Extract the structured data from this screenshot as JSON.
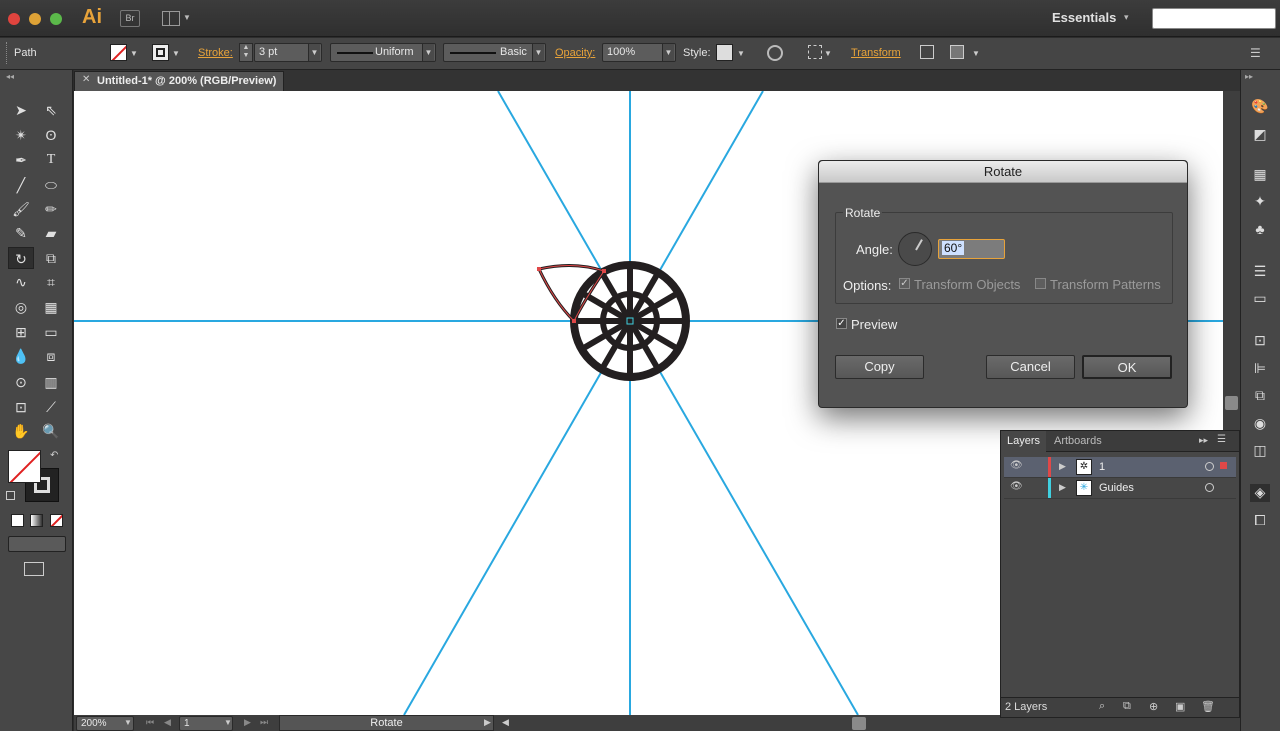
{
  "app": {
    "logo": "Ai",
    "bridge": "Br",
    "workspace": "Essentials"
  },
  "control": {
    "selection": "Path",
    "stroke_label": "Stroke:",
    "stroke_weight": "3 pt",
    "profile": "Uniform",
    "brush": "Basic",
    "opacity_label": "Opacity:",
    "opacity": "100%",
    "style_label": "Style:",
    "transform": "Transform"
  },
  "document": {
    "tab": "Untitled-1* @ 200% (RGB/Preview)"
  },
  "status": {
    "zoom": "200%",
    "page": "1",
    "tool": "Rotate"
  },
  "dialog": {
    "title": "Rotate",
    "group": "Rotate",
    "angle_label": "Angle:",
    "angle": "60°",
    "options_label": "Options:",
    "transform_objects": "Transform Objects",
    "transform_patterns": "Transform Patterns",
    "preview": "Preview",
    "copy": "Copy",
    "cancel": "Cancel",
    "ok": "OK"
  },
  "layers": {
    "tabs": [
      "Layers",
      "Artboards"
    ],
    "rows": [
      {
        "name": "1",
        "color": "#e04848"
      },
      {
        "name": "Guides",
        "color": "#40d0e0"
      }
    ],
    "count": "2 Layers"
  },
  "colors": {
    "accent": "#e8a33a",
    "guide": "#29a8e0",
    "art": "#231f20"
  }
}
